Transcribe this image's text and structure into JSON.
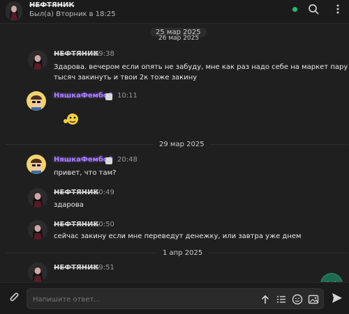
{
  "header": {
    "name": "НЕФТЯНИК",
    "status": "Был(а) Вторник в 18:25",
    "online_color": "#1fbf6b"
  },
  "chat": {
    "pills": [
      "25 мар 2025"
    ],
    "date_separators": [
      "26 мар 2025",
      "29 мар 2025",
      "1 апр 2025"
    ],
    "messages": [
      {
        "name": "НЕФТЯНИК",
        "time": "09:38",
        "text_lines": [
          "Здарова. вечером если опять не забуду, мне как раз надо себе на маркет пару",
          "тысяч закинуть и твои 2к тоже закину"
        ],
        "avatar": "girl-avatar"
      },
      {
        "name": "НяшкаФембой",
        "time": "10:11",
        "text_lines": [],
        "avatar": "cartoon-avatar",
        "sticker": "emoji-sticker"
      },
      {
        "name": "НяшкаФембой",
        "time": "20:48",
        "text_lines": [
          "привет, что там?"
        ],
        "avatar": "cartoon-avatar"
      },
      {
        "name": "НЕФТЯНИК",
        "time": "20:49",
        "text_lines": [
          "здарова"
        ],
        "avatar": "girl-avatar"
      },
      {
        "name": "НЕФТЯНИК",
        "time": "20:50",
        "text_lines": [
          "сейчас закину если мне переведут денежку, или завтра уже днем"
        ],
        "avatar": "girl-avatar"
      },
      {
        "name": "НЕФТЯНИК",
        "time": "09:51",
        "text_lines": [],
        "avatar": "girl-avatar"
      }
    ]
  },
  "footer": {
    "placeholder": "Напишите ответ..."
  },
  "colors": {
    "accent": "#1f6b52",
    "purple_name": "#a57bff"
  },
  "icons": [
    "search-icon",
    "more-icon",
    "scroll-down-icon",
    "attach-icon",
    "arrow-up-icon",
    "list-icon",
    "emoji-icon",
    "image-icon",
    "send-icon",
    "cat-icon"
  ]
}
